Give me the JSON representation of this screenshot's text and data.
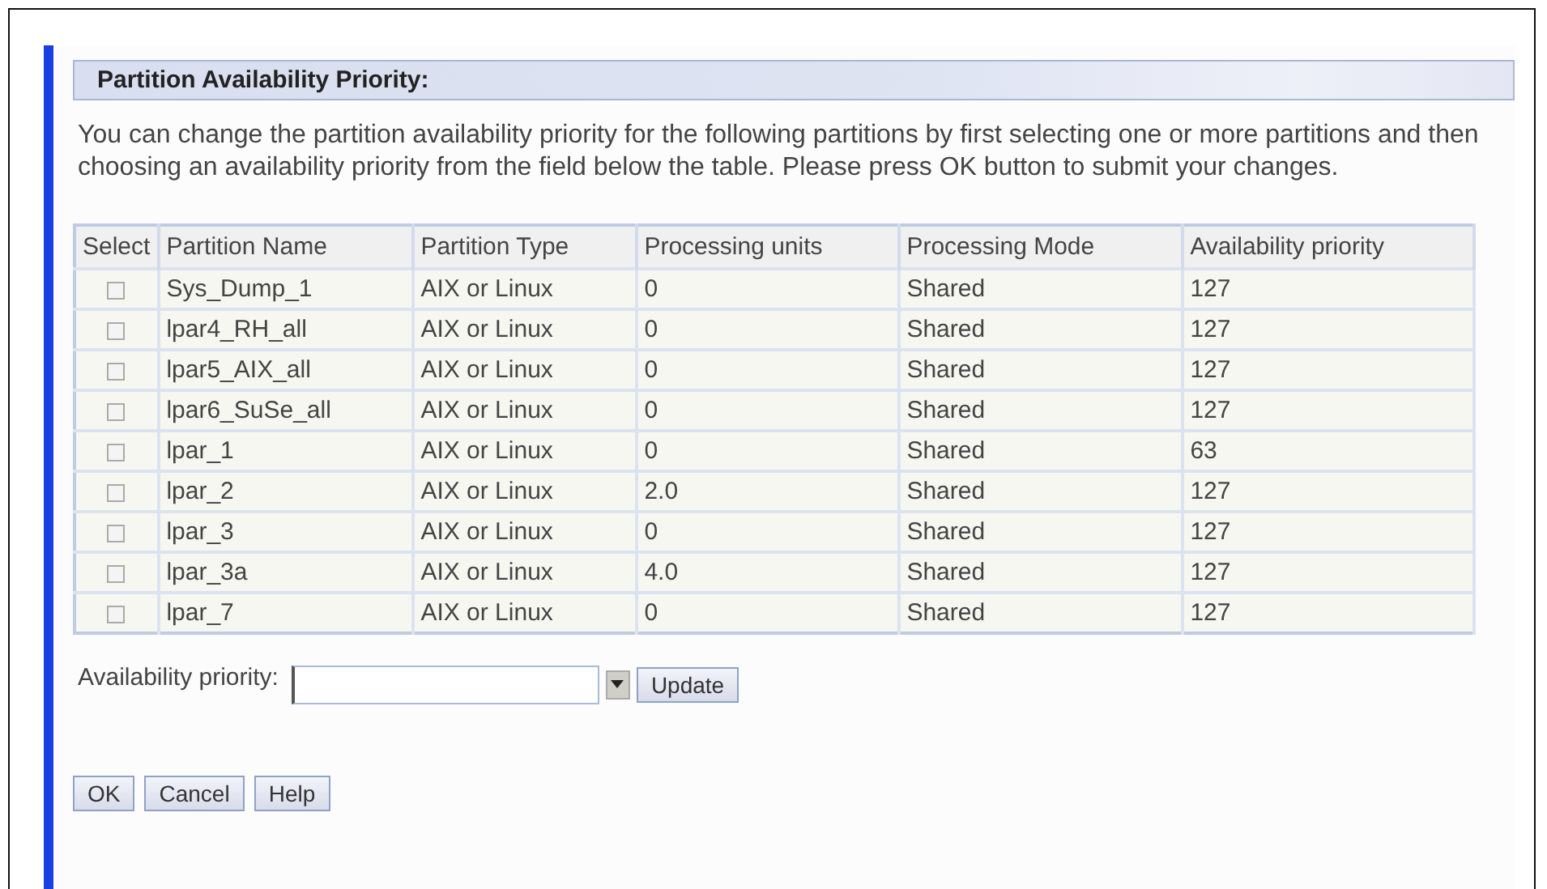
{
  "section_title": "Partition Availability Priority:",
  "description": "You can change the partition availability priority for the following partitions by first selecting one or more partitions and then choosing an availability priority from the field below the table. Please press OK button to submit your changes.",
  "table": {
    "select_column": "Select",
    "columns": [
      "Partition Name",
      "Partition Type",
      "Processing units",
      "Processing Mode",
      "Availability priority"
    ],
    "rows": [
      {
        "checked": false,
        "cells": [
          "Sys_Dump_1",
          "AIX or Linux",
          "0",
          "Shared",
          "127"
        ]
      },
      {
        "checked": false,
        "cells": [
          "lpar4_RH_all",
          "AIX or Linux",
          "0",
          "Shared",
          "127"
        ]
      },
      {
        "checked": false,
        "cells": [
          "lpar5_AIX_all",
          "AIX or Linux",
          "0",
          "Shared",
          "127"
        ]
      },
      {
        "checked": false,
        "cells": [
          "lpar6_SuSe_all",
          "AIX or Linux",
          "0",
          "Shared",
          "127"
        ]
      },
      {
        "checked": false,
        "cells": [
          "lpar_1",
          "AIX or Linux",
          "0",
          "Shared",
          "63"
        ]
      },
      {
        "checked": false,
        "cells": [
          "lpar_2",
          "AIX or Linux",
          "2.0",
          "Shared",
          "127"
        ]
      },
      {
        "checked": false,
        "cells": [
          "lpar_3",
          "AIX or Linux",
          "0",
          "Shared",
          "127"
        ]
      },
      {
        "checked": false,
        "cells": [
          "lpar_3a",
          "AIX or Linux",
          "4.0",
          "Shared",
          "127"
        ]
      },
      {
        "checked": false,
        "cells": [
          "lpar_7",
          "AIX or Linux",
          "0",
          "Shared",
          "127"
        ]
      }
    ]
  },
  "priority_field": {
    "label": "Availability priority:"
  },
  "update_button": "Update",
  "buttons": [
    "OK",
    "Cancel",
    "Help"
  ]
}
